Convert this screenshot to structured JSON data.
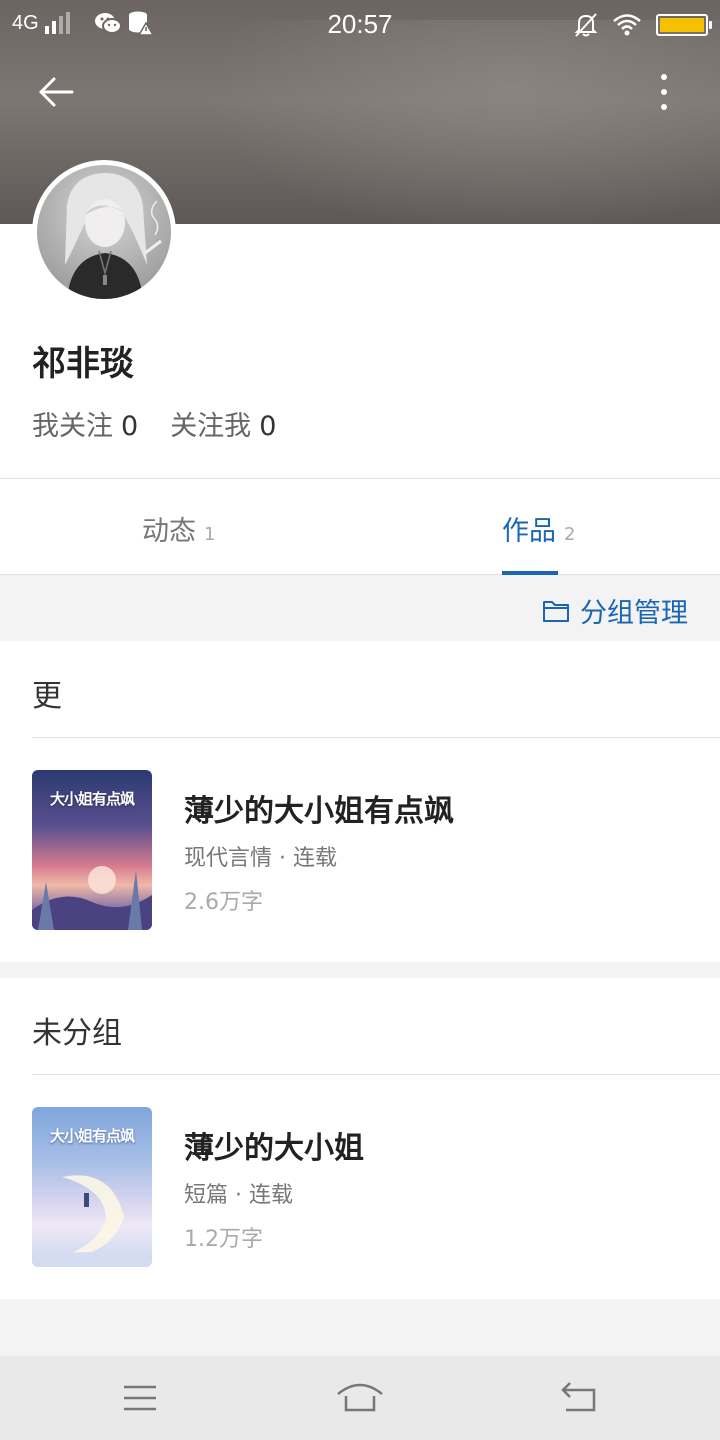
{
  "status_bar": {
    "network": "4G",
    "time": "20:57",
    "battery_color": "#f5c000"
  },
  "header": {
    "back_icon": "arrow-left-icon",
    "more_icon": "more-vertical-icon"
  },
  "profile": {
    "name": "祁非琰",
    "following_label": "我关注",
    "following_count": "0",
    "followers_label": "关注我",
    "followers_count": "0"
  },
  "tabs": [
    {
      "label": "动态",
      "count": "1",
      "active": false
    },
    {
      "label": "作品",
      "count": "2",
      "active": true
    }
  ],
  "group_manage": {
    "icon": "folder-icon",
    "label": "分组管理"
  },
  "groups": [
    {
      "title": "更",
      "books": [
        {
          "title": "薄少的大小姐有点飒",
          "meta": "现代言情 · 连载",
          "words": "2.6万字",
          "cover_text": "大小姐有点飒"
        }
      ]
    },
    {
      "title": "未分组",
      "books": [
        {
          "title": "薄少的大小姐",
          "meta": "短篇 · 连载",
          "words": "1.2万字",
          "cover_text": "大小姐有点飒"
        }
      ]
    }
  ],
  "nav_bar": {
    "menu_icon": "menu-icon",
    "home_icon": "home-icon",
    "back_icon": "return-icon"
  },
  "colors": {
    "accent": "#1a66b5"
  }
}
